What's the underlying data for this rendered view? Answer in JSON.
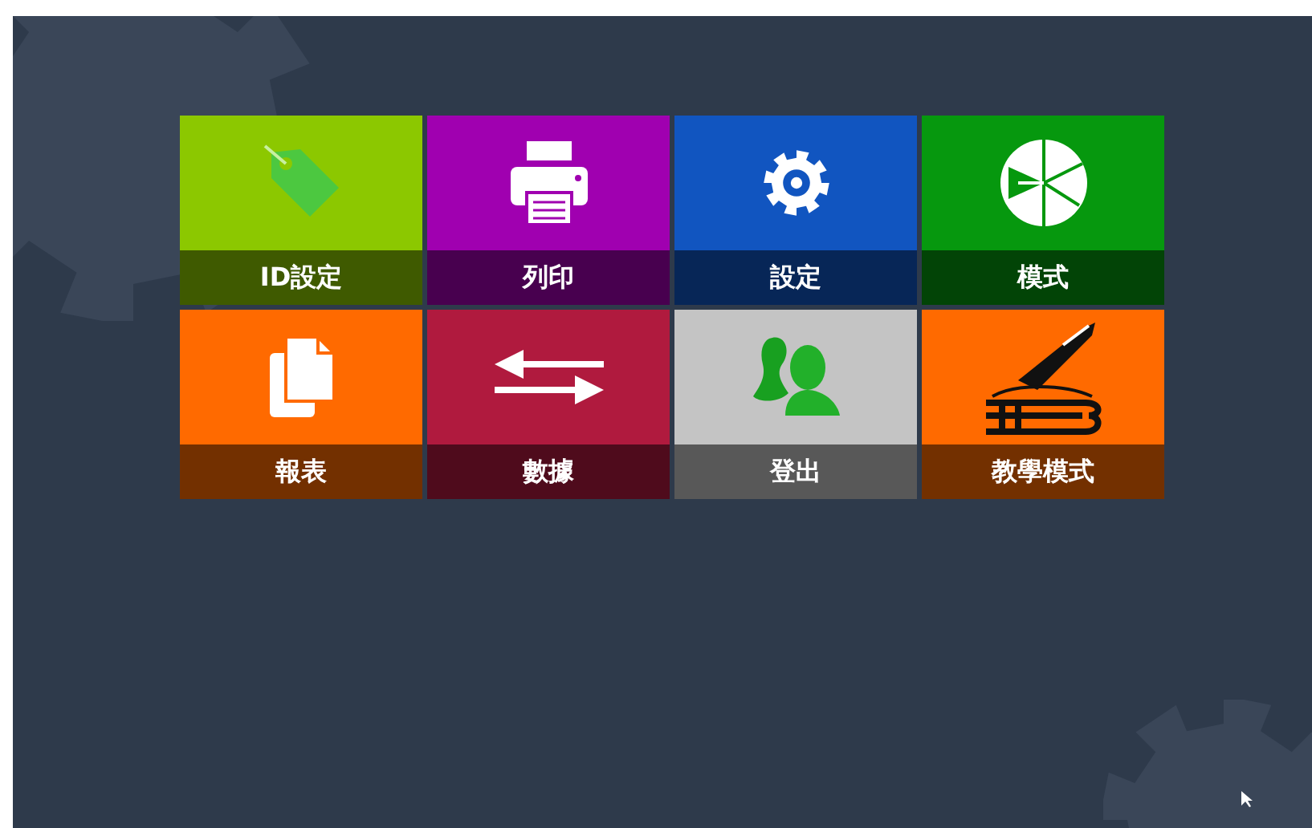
{
  "tiles": [
    {
      "label": "ID設定",
      "kind": "tag",
      "color": "#8cc800"
    },
    {
      "label": "列印",
      "kind": "printer",
      "color": "#a000b0"
    },
    {
      "label": "設定",
      "kind": "gear",
      "color": "#1155c0"
    },
    {
      "label": "模式",
      "kind": "dial",
      "color": "#06980e"
    },
    {
      "label": "報表",
      "kind": "pages",
      "color": "#ff6a00"
    },
    {
      "label": "數據",
      "kind": "arrows",
      "color": "#b01a3e"
    },
    {
      "label": "登出",
      "kind": "users",
      "color": "#c4c4c4"
    },
    {
      "label": "教學模式",
      "kind": "pen",
      "color": "#ff6a00"
    }
  ]
}
